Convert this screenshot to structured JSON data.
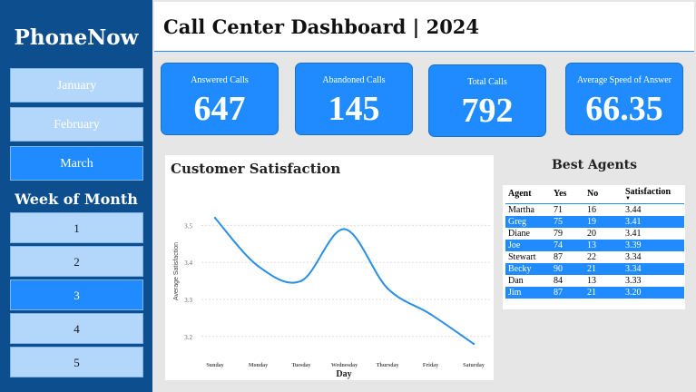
{
  "sidebar": {
    "brand": "PhoneNow",
    "months": [
      {
        "label": "January",
        "active": false
      },
      {
        "label": "February",
        "active": false
      },
      {
        "label": "March",
        "active": true
      }
    ],
    "week_title": "Week of Month",
    "weeks": [
      {
        "label": "1",
        "active": false
      },
      {
        "label": "2",
        "active": false
      },
      {
        "label": "3",
        "active": true
      },
      {
        "label": "4",
        "active": false
      },
      {
        "label": "5",
        "active": false
      }
    ]
  },
  "header": {
    "title": "Call Center Dashboard | 2024"
  },
  "kpis": [
    {
      "label": "Answered Calls",
      "value": "647"
    },
    {
      "label": "Abandoned Calls",
      "value": "145"
    },
    {
      "label": "Total Calls",
      "value": "792"
    },
    {
      "label": "Average Speed of Answer",
      "value": "66.35"
    }
  ],
  "chart_data": {
    "type": "line",
    "title": "Customer Satisfaction",
    "xlabel": "Day",
    "ylabel": "Average Satisfaction",
    "categories": [
      "Sunday",
      "Monday",
      "Tuesday",
      "Wednesday",
      "Thursday",
      "Friday",
      "Saturday"
    ],
    "values": [
      3.52,
      3.39,
      3.35,
      3.49,
      3.33,
      3.26,
      3.18
    ],
    "yticks": [
      "3.2",
      "3.3",
      "3.4",
      "3.5"
    ],
    "ylim": [
      3.17,
      3.55
    ],
    "grid": true,
    "color": "#2b8fe6"
  },
  "agents": {
    "title": "Best Agents",
    "columns": [
      "Agent",
      "Yes",
      "No",
      "Satisfaction"
    ],
    "rows": [
      [
        "Martha",
        "71",
        "16",
        "3.44"
      ],
      [
        "Greg",
        "75",
        "19",
        "3.41"
      ],
      [
        "Diane",
        "79",
        "20",
        "3.41"
      ],
      [
        "Joe",
        "74",
        "13",
        "3.39"
      ],
      [
        "Stewart",
        "87",
        "22",
        "3.34"
      ],
      [
        "Becky",
        "90",
        "21",
        "3.34"
      ],
      [
        "Dan",
        "84",
        "13",
        "3.33"
      ],
      [
        "Jim",
        "87",
        "21",
        "3.20"
      ]
    ]
  },
  "colors": {
    "sidebar": "#0d4e8f",
    "accent": "#1f8bff",
    "light": "#b3d6fb"
  }
}
